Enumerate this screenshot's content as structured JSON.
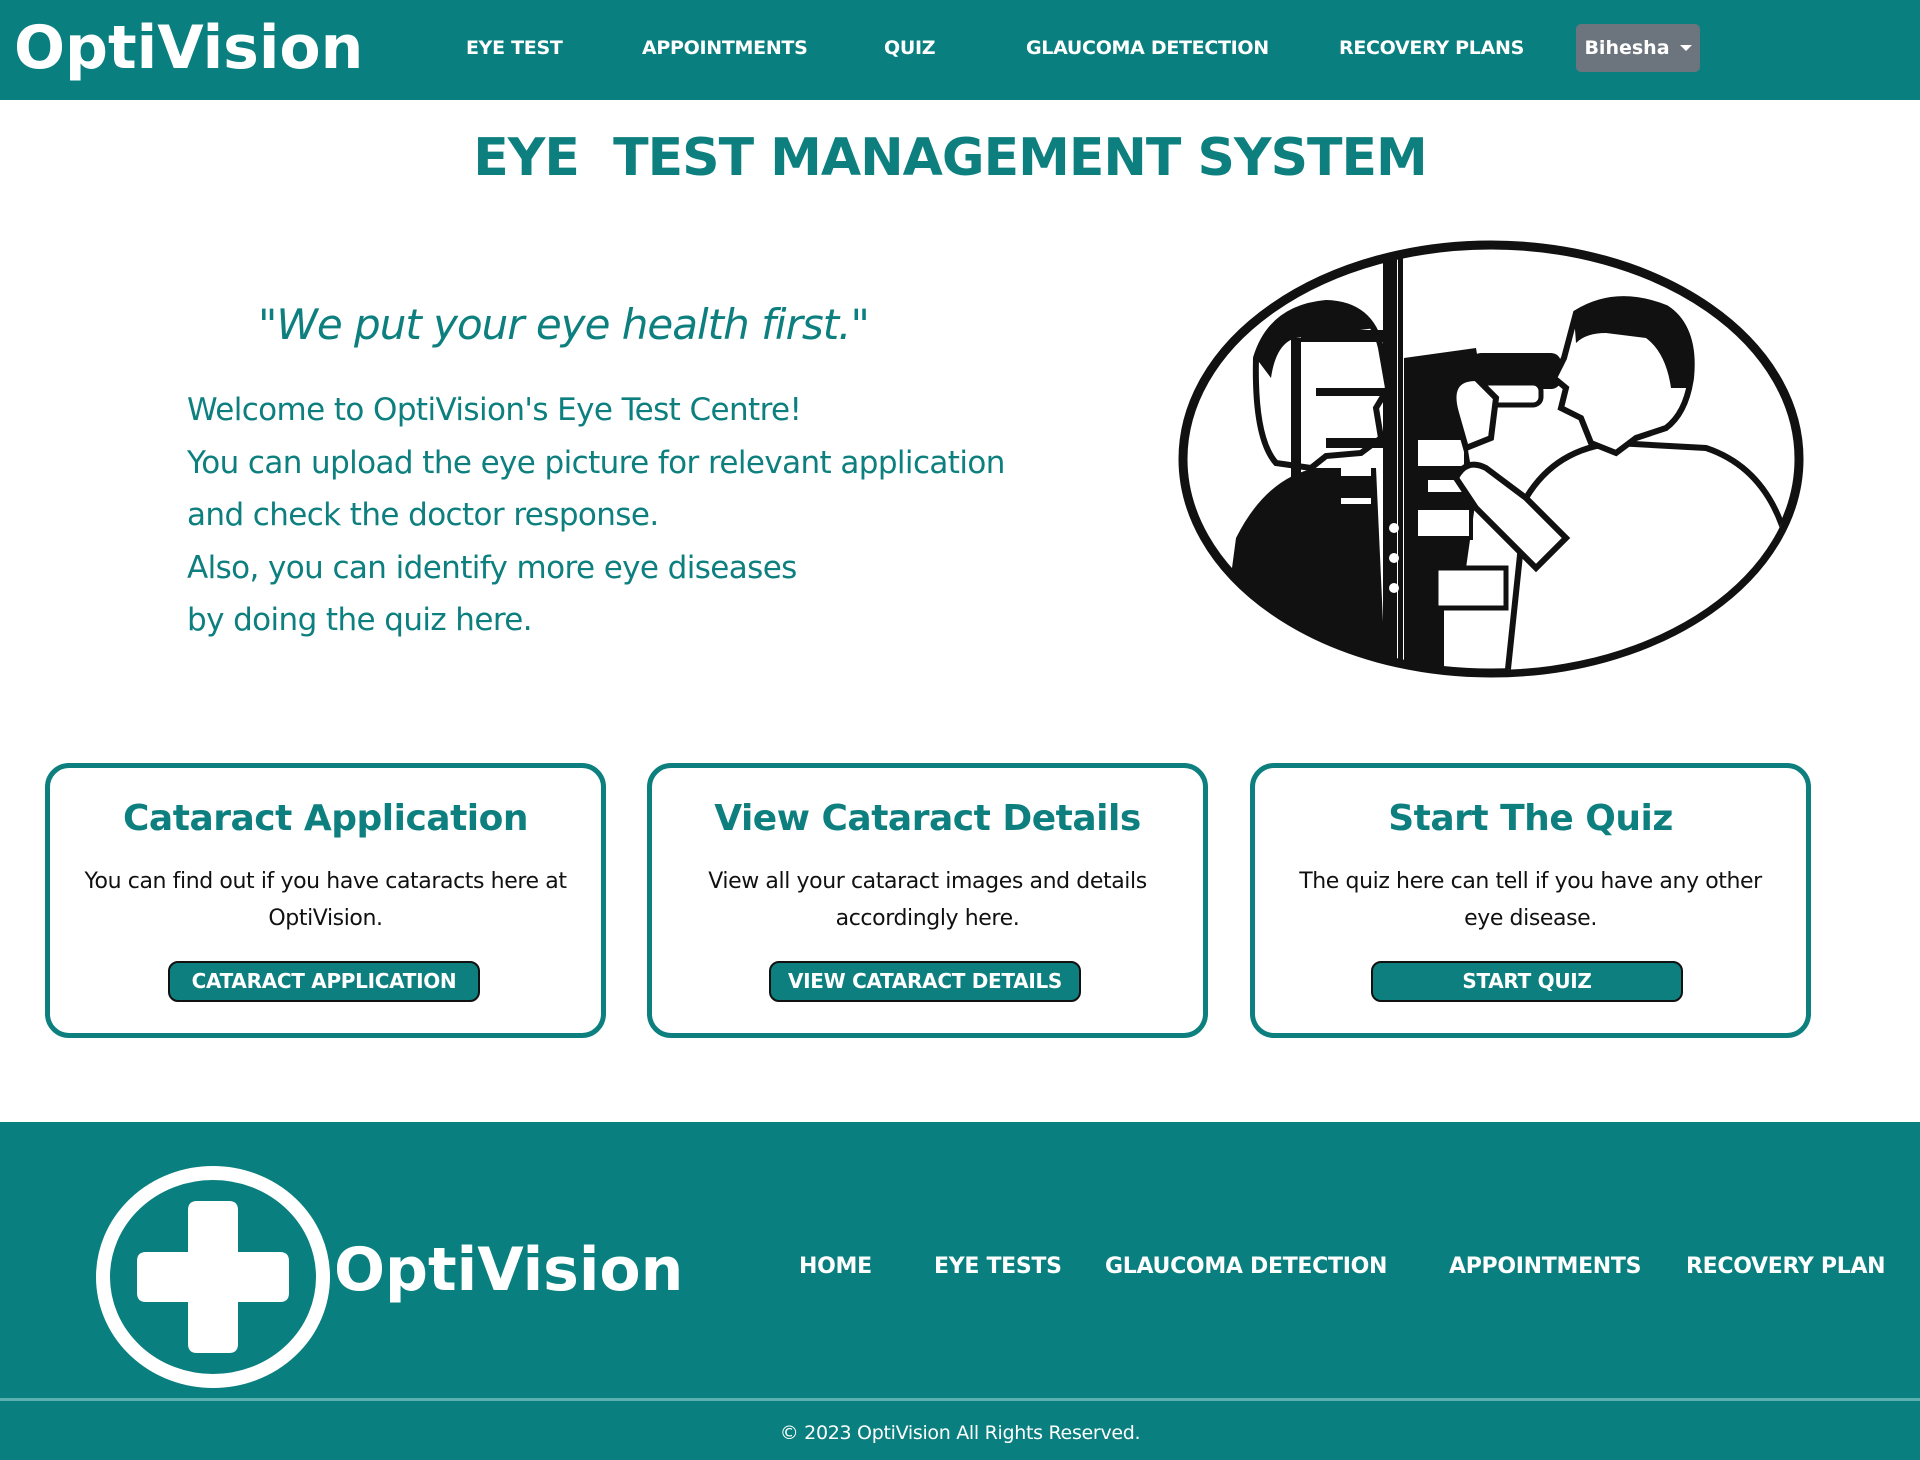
{
  "navbar": {
    "brand": "OptiVision",
    "links": [
      "EYE TEST",
      "APPOINTMENTS",
      "QUIZ",
      "GLAUCOMA DETECTION",
      "RECOVERY PLANS"
    ],
    "user": "Bihesha"
  },
  "hero": {
    "title": "EYE  TEST MANAGEMENT SYSTEM",
    "tagline": "\"We put your eye health first.\"",
    "intro_lines": [
      "Welcome to OptiVision's Eye Test Centre!",
      "You can upload the eye picture for relevant application",
      "and check the doctor response.",
      "Also, you can identify more eye diseases",
      "by doing the quiz here."
    ]
  },
  "cards": [
    {
      "title": "Cataract Application",
      "text": "You can find out if you have cataracts here at OptiVision.",
      "button": "CATARACT APPLICATION"
    },
    {
      "title": "View Cataract Details",
      "text": "View all your cataract images and details accordingly here.",
      "button": "VIEW CATARACT DETAILS"
    },
    {
      "title": "Start The Quiz",
      "text": "The quiz here can tell if you have any other eye disease.",
      "button": "START QUIZ"
    }
  ],
  "footer": {
    "brand": "OptiVision",
    "links": [
      "HOME",
      "EYE TESTS",
      "GLAUCOMA DETECTION",
      "APPOINTMENTS",
      "RECOVERY PLAN"
    ],
    "copyright": "© 2023 OptiVision All Rights Reserved."
  },
  "colors": {
    "primary": "#0a7f7f",
    "user_button": "#6c757d"
  },
  "icons": {
    "footer_logo": "medical-cross-icon",
    "user_caret": "caret-down-icon"
  }
}
